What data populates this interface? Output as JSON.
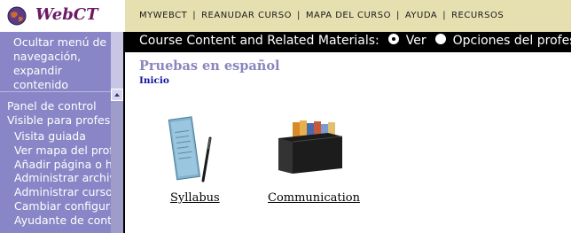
{
  "logo": {
    "text": "WebCT",
    "icon": "globe-icon"
  },
  "topnav": {
    "items": [
      "MYWEBCT",
      "REANUDAR CURSO",
      "MAPA DEL CURSO",
      "AYUDA",
      "RECURSOS"
    ],
    "separator": "|"
  },
  "contentbar": {
    "label": "Course Content and Related Materials:",
    "option_view": "Ver",
    "option_designer": "Opciones del profesor",
    "selected": "Ver"
  },
  "sidebar": {
    "collapse_link": "Ocultar menú de navegación, expandir contenido",
    "panel_title": "Panel de control",
    "visible_title": "Visible para profesor",
    "items": [
      "Visita guiada",
      "Ver mapa del profe",
      "Añadir página o he",
      "Administrar archivo",
      "Administrar curso",
      "Cambiar configurad",
      "Ayudante de conte"
    ]
  },
  "main": {
    "title": "Pruebas en español",
    "breadcrumb": "Inicio",
    "tools": [
      {
        "label": "Syllabus",
        "icon": "syllabus-document-pen-icon"
      },
      {
        "label": "Communication",
        "icon": "file-folders-icon"
      }
    ]
  },
  "colors": {
    "sidebar": "#8886c6",
    "topnav": "#e6e0b1",
    "contentbar": "#000000",
    "title": "#8a86bd",
    "breadcrumb": "#1414a0",
    "logo": "#6b1a66"
  }
}
